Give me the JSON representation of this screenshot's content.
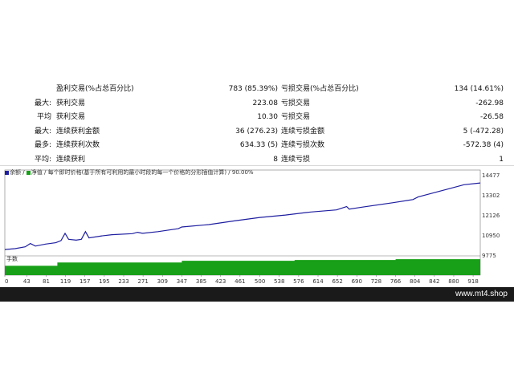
{
  "stats": {
    "rows": [
      [
        "",
        "盈利交易(%占总百分比)",
        "783 (85.39%)",
        "亏损交易(%占总百分比)",
        "134 (14.61%)"
      ],
      [
        "最大:",
        "获利交易",
        "223.08",
        "亏损交易",
        "-262.98"
      ],
      [
        "平均",
        "获利交易",
        "10.30",
        "亏损交易",
        "-26.58"
      ],
      [
        "最大:",
        "连续获利金额",
        "36 (276.23)",
        "连续亏损金额",
        "5 (-472.28)"
      ],
      [
        "最多:",
        "连续获利次数",
        "634.33 (5)",
        "连续亏损次数",
        "-572.38 (4)"
      ],
      [
        "平均:",
        "连续获利",
        "8",
        "连续亏损",
        "1"
      ]
    ]
  },
  "chart": {
    "legend_balance": "余额",
    "legend_equity": "净值",
    "legend_text": "每个即时价格(基于所有可利用的最小时段的每一个价格的分形插值计算) / 90.00%",
    "volume_label": "手数",
    "colors": {
      "line": "#1e1ea0",
      "volume": "#18a018",
      "axis": "#777777"
    }
  },
  "chart_data": {
    "type": "line",
    "x_ticks": [
      "0",
      "43",
      "81",
      "119",
      "157",
      "195",
      "233",
      "271",
      "309",
      "347",
      "385",
      "423",
      "461",
      "500",
      "538",
      "576",
      "614",
      "652",
      "690",
      "728",
      "766",
      "804",
      "842",
      "880",
      "918"
    ],
    "y_ticks": [
      "14477",
      "13302",
      "12126",
      "10950",
      "9775"
    ],
    "ylim": [
      9775,
      14477
    ],
    "xlim": [
      0,
      932
    ],
    "balance": [
      [
        0,
        10100
      ],
      [
        20,
        10150
      ],
      [
        40,
        10260
      ],
      [
        50,
        10450
      ],
      [
        60,
        10300
      ],
      [
        80,
        10420
      ],
      [
        100,
        10500
      ],
      [
        110,
        10620
      ],
      [
        118,
        11050
      ],
      [
        125,
        10700
      ],
      [
        140,
        10650
      ],
      [
        150,
        10700
      ],
      [
        158,
        11150
      ],
      [
        165,
        10780
      ],
      [
        190,
        10900
      ],
      [
        210,
        10970
      ],
      [
        250,
        11030
      ],
      [
        260,
        11110
      ],
      [
        270,
        11050
      ],
      [
        300,
        11150
      ],
      [
        340,
        11320
      ],
      [
        347,
        11420
      ],
      [
        400,
        11560
      ],
      [
        450,
        11780
      ],
      [
        500,
        11980
      ],
      [
        550,
        12120
      ],
      [
        600,
        12300
      ],
      [
        650,
        12420
      ],
      [
        670,
        12620
      ],
      [
        675,
        12470
      ],
      [
        700,
        12580
      ],
      [
        760,
        12840
      ],
      [
        800,
        13030
      ],
      [
        810,
        13180
      ],
      [
        830,
        13340
      ],
      [
        870,
        13660
      ],
      [
        900,
        13900
      ],
      [
        932,
        14000
      ]
    ],
    "volume_steps": [
      [
        0,
        0.55
      ],
      [
        103,
        0.75
      ],
      [
        347,
        0.85
      ],
      [
        568,
        0.9
      ],
      [
        766,
        0.95
      ],
      [
        932,
        0.95
      ]
    ]
  },
  "footer": {
    "site": "www.mt4.shop"
  }
}
